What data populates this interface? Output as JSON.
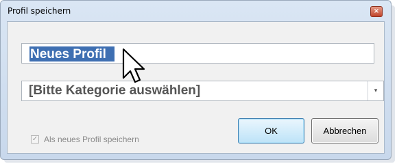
{
  "dialog": {
    "title": "Profil speichern",
    "close_glyph": "×"
  },
  "name_field": {
    "value": "Neues Profil",
    "selected": true
  },
  "category_select": {
    "selected_value": "[Bitte Kategorie auswählen]",
    "arrow_glyph": "▾"
  },
  "save_as_new": {
    "label": "Als neues Profil speichern",
    "checked": true,
    "disabled": true,
    "check_glyph": "✓"
  },
  "buttons": {
    "ok_label": "OK",
    "cancel_label": "Abbrechen"
  },
  "cursor": {
    "icon": "arrow-pointer-icon"
  },
  "colors": {
    "selection": "#3e6fb2",
    "ok_border": "#3c7fb1",
    "close_button": "#c0442b"
  }
}
